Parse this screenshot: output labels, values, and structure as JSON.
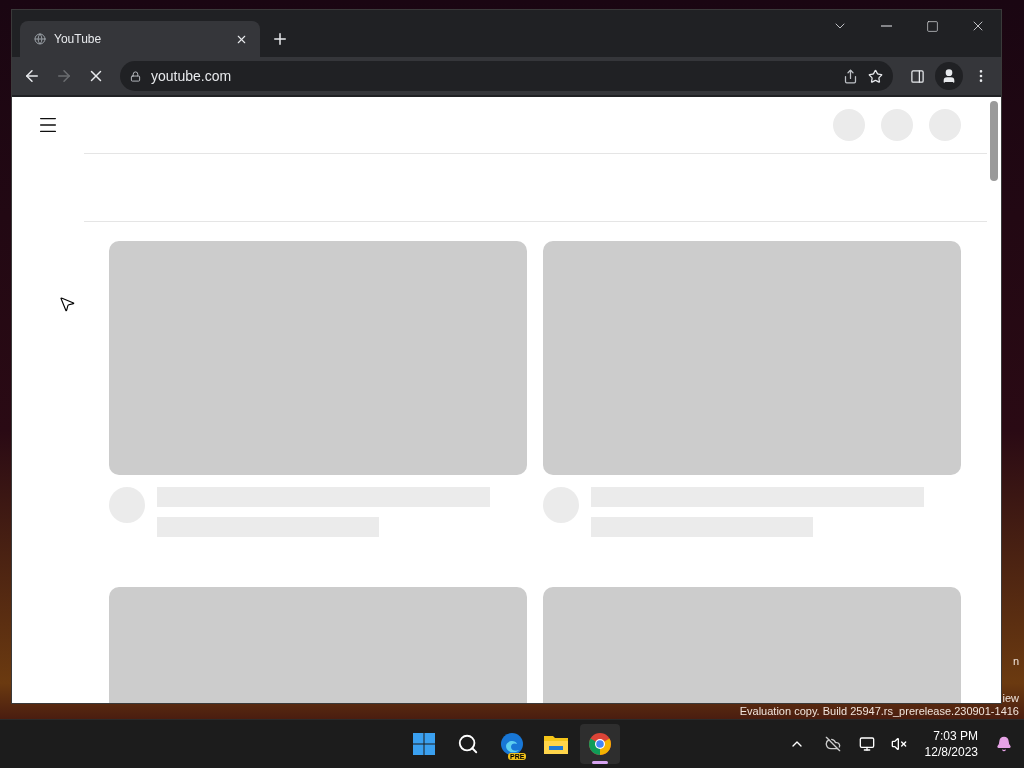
{
  "browser": {
    "tab": {
      "title": "YouTube",
      "selected": true
    },
    "navigation": {
      "back_disabled": false,
      "forward_disabled": true,
      "loading": true
    },
    "address_bar": {
      "url": "youtube.com"
    }
  },
  "desktop_watermark": {
    "lines": [
      "n",
      "iew",
      "Evaluation copy. Build 25947.rs_prerelease.230901-1416"
    ]
  },
  "taskbar": {
    "apps": [
      {
        "kind": "start",
        "selected": false
      },
      {
        "kind": "search",
        "selected": false
      },
      {
        "kind": "edge",
        "badge": "PRE",
        "selected": false
      },
      {
        "kind": "files",
        "selected": false
      },
      {
        "kind": "chrome",
        "selected": true
      }
    ],
    "clock": {
      "time": "7:03 PM",
      "date": "12/8/2023"
    }
  }
}
